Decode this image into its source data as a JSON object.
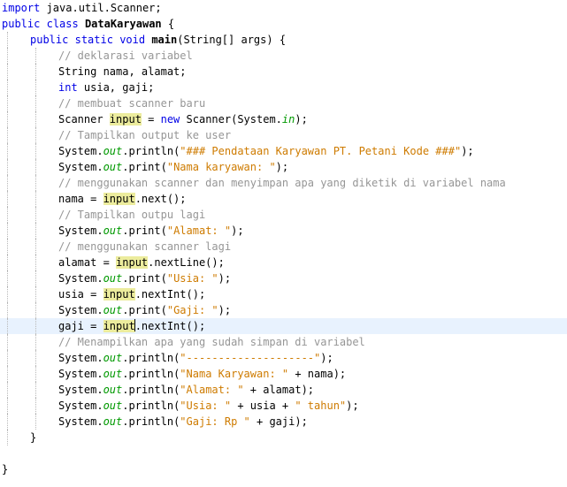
{
  "editor": {
    "lines": [
      {
        "indent": 0,
        "tokens": [
          {
            "t": "kw",
            "v": "import"
          },
          {
            "t": "plain",
            "v": " java.util.Scanner;"
          }
        ]
      },
      {
        "indent": 0,
        "tokens": [
          {
            "t": "kw",
            "v": "public"
          },
          {
            "t": "plain",
            "v": " "
          },
          {
            "t": "kw",
            "v": "class"
          },
          {
            "t": "plain",
            "v": " "
          },
          {
            "t": "bold",
            "v": "DataKaryawan"
          },
          {
            "t": "plain",
            "v": " {"
          }
        ]
      },
      {
        "indent": 1,
        "tokens": [
          {
            "t": "kw",
            "v": "public"
          },
          {
            "t": "plain",
            "v": " "
          },
          {
            "t": "kw",
            "v": "static"
          },
          {
            "t": "plain",
            "v": " "
          },
          {
            "t": "kw",
            "v": "void"
          },
          {
            "t": "plain",
            "v": " "
          },
          {
            "t": "mth",
            "v": "main"
          },
          {
            "t": "plain",
            "v": "(String[] args) {"
          }
        ]
      },
      {
        "indent": 2,
        "tokens": [
          {
            "t": "cmt",
            "v": "// deklarasi variabel"
          }
        ]
      },
      {
        "indent": 2,
        "tokens": [
          {
            "t": "plain",
            "v": "String nama, alamat;"
          }
        ]
      },
      {
        "indent": 2,
        "tokens": [
          {
            "t": "kw",
            "v": "int"
          },
          {
            "t": "plain",
            "v": " usia, gaji;"
          }
        ]
      },
      {
        "indent": 2,
        "tokens": [
          {
            "t": "cmt",
            "v": "// membuat scanner baru"
          }
        ]
      },
      {
        "indent": 2,
        "tokens": [
          {
            "t": "plain",
            "v": "Scanner "
          },
          {
            "t": "hl",
            "v": "input"
          },
          {
            "t": "plain",
            "v": " = "
          },
          {
            "t": "kw",
            "v": "new"
          },
          {
            "t": "plain",
            "v": " Scanner(System."
          },
          {
            "t": "fld",
            "v": "in"
          },
          {
            "t": "plain",
            "v": ");"
          }
        ]
      },
      {
        "indent": 2,
        "tokens": [
          {
            "t": "cmt",
            "v": "// Tampilkan output ke user"
          }
        ]
      },
      {
        "indent": 2,
        "tokens": [
          {
            "t": "plain",
            "v": "System."
          },
          {
            "t": "fld",
            "v": "out"
          },
          {
            "t": "plain",
            "v": ".println("
          },
          {
            "t": "str",
            "v": "\"### Pendataan Karyawan PT. Petani Kode ###\""
          },
          {
            "t": "plain",
            "v": ");"
          }
        ]
      },
      {
        "indent": 2,
        "tokens": [
          {
            "t": "plain",
            "v": "System."
          },
          {
            "t": "fld",
            "v": "out"
          },
          {
            "t": "plain",
            "v": ".print("
          },
          {
            "t": "str",
            "v": "\"Nama karyawan: \""
          },
          {
            "t": "plain",
            "v": ");"
          }
        ]
      },
      {
        "indent": 2,
        "tokens": [
          {
            "t": "cmt",
            "v": "// menggunakan scanner dan menyimpan apa yang diketik di variabel nama"
          }
        ]
      },
      {
        "indent": 2,
        "tokens": [
          {
            "t": "plain",
            "v": "nama = "
          },
          {
            "t": "hl",
            "v": "input"
          },
          {
            "t": "plain",
            "v": ".next();"
          }
        ]
      },
      {
        "indent": 2,
        "tokens": [
          {
            "t": "cmt",
            "v": "// Tampilkan outpu lagi"
          }
        ]
      },
      {
        "indent": 2,
        "tokens": [
          {
            "t": "plain",
            "v": "System."
          },
          {
            "t": "fld",
            "v": "out"
          },
          {
            "t": "plain",
            "v": ".print("
          },
          {
            "t": "str",
            "v": "\"Alamat: \""
          },
          {
            "t": "plain",
            "v": ");"
          }
        ]
      },
      {
        "indent": 2,
        "tokens": [
          {
            "t": "cmt",
            "v": "// menggunakan scanner lagi"
          }
        ]
      },
      {
        "indent": 2,
        "tokens": [
          {
            "t": "plain",
            "v": "alamat = "
          },
          {
            "t": "hl",
            "v": "input"
          },
          {
            "t": "plain",
            "v": ".nextLine();"
          }
        ]
      },
      {
        "indent": 2,
        "tokens": [
          {
            "t": "plain",
            "v": "System."
          },
          {
            "t": "fld",
            "v": "out"
          },
          {
            "t": "plain",
            "v": ".print("
          },
          {
            "t": "str",
            "v": "\"Usia: \""
          },
          {
            "t": "plain",
            "v": ");"
          }
        ]
      },
      {
        "indent": 2,
        "tokens": [
          {
            "t": "plain",
            "v": "usia = "
          },
          {
            "t": "hl",
            "v": "input"
          },
          {
            "t": "plain",
            "v": ".nextInt();"
          }
        ]
      },
      {
        "indent": 2,
        "tokens": [
          {
            "t": "plain",
            "v": "System."
          },
          {
            "t": "fld",
            "v": "out"
          },
          {
            "t": "plain",
            "v": ".print("
          },
          {
            "t": "str",
            "v": "\"Gaji: \""
          },
          {
            "t": "plain",
            "v": ");"
          }
        ]
      },
      {
        "indent": 2,
        "current": true,
        "tokens": [
          {
            "t": "plain",
            "v": "gaji = "
          },
          {
            "t": "hl",
            "v": "input"
          },
          {
            "t": "caret",
            "v": ""
          },
          {
            "t": "plain",
            "v": ".nextInt();"
          }
        ]
      },
      {
        "indent": 2,
        "tokens": [
          {
            "t": "cmt",
            "v": "// Menampilkan apa yang sudah simpan di variabel"
          }
        ]
      },
      {
        "indent": 2,
        "tokens": [
          {
            "t": "plain",
            "v": "System."
          },
          {
            "t": "fld",
            "v": "out"
          },
          {
            "t": "plain",
            "v": ".println("
          },
          {
            "t": "str",
            "v": "\"--------------------\""
          },
          {
            "t": "plain",
            "v": ");"
          }
        ]
      },
      {
        "indent": 2,
        "tokens": [
          {
            "t": "plain",
            "v": "System."
          },
          {
            "t": "fld",
            "v": "out"
          },
          {
            "t": "plain",
            "v": ".println("
          },
          {
            "t": "str",
            "v": "\"Nama Karyawan: \""
          },
          {
            "t": "plain",
            "v": " + nama);"
          }
        ]
      },
      {
        "indent": 2,
        "tokens": [
          {
            "t": "plain",
            "v": "System."
          },
          {
            "t": "fld",
            "v": "out"
          },
          {
            "t": "plain",
            "v": ".println("
          },
          {
            "t": "str",
            "v": "\"Alamat: \""
          },
          {
            "t": "plain",
            "v": " + alamat);"
          }
        ]
      },
      {
        "indent": 2,
        "tokens": [
          {
            "t": "plain",
            "v": "System."
          },
          {
            "t": "fld",
            "v": "out"
          },
          {
            "t": "plain",
            "v": ".println("
          },
          {
            "t": "str",
            "v": "\"Usia: \""
          },
          {
            "t": "plain",
            "v": " + usia + "
          },
          {
            "t": "str",
            "v": "\" tahun\""
          },
          {
            "t": "plain",
            "v": ");"
          }
        ]
      },
      {
        "indent": 2,
        "tokens": [
          {
            "t": "plain",
            "v": "System."
          },
          {
            "t": "fld",
            "v": "out"
          },
          {
            "t": "plain",
            "v": ".println("
          },
          {
            "t": "str",
            "v": "\"Gaji: Rp \""
          },
          {
            "t": "plain",
            "v": " + gaji);"
          }
        ]
      },
      {
        "indent": 1,
        "tokens": [
          {
            "t": "plain",
            "v": "}"
          }
        ]
      },
      {
        "indent": 0,
        "tokens": []
      },
      {
        "indent": 0,
        "tokens": [
          {
            "t": "plain",
            "v": "}"
          }
        ]
      }
    ],
    "colors": {
      "keyword": "#0000e6",
      "string": "#ce7b00",
      "comment": "#969696",
      "field": "#009900",
      "occurrence_highlight": "#ecec9d",
      "current_line": "#e8f2fe"
    }
  }
}
